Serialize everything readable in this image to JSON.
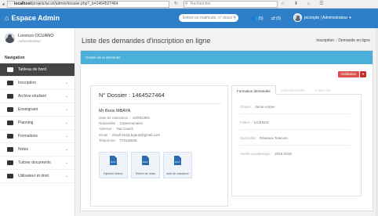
{
  "browser": {
    "url_host": "localhost",
    "url_path": "/projets/iai.sn/admin/dossier.php?_b=1464527464",
    "search_placeholder": "Rechercher",
    "reload_icon": "reload-icon",
    "toolbar_icons": "☆ ⬇ ⌂ ☰"
  },
  "header": {
    "brand": "Espace Admin",
    "search_placeholder": "Entrer un matricule, n° dossi",
    "notif1": "(0)",
    "notif2": "(0)",
    "user_label": "pcompte | Administrateur"
  },
  "sidebar": {
    "profile_name": "Lorenzo OCUANO",
    "profile_role": "Administrateur",
    "nav_heading": "Navigation",
    "items": [
      {
        "label": "Tableau de bord"
      },
      {
        "label": "Inscription"
      },
      {
        "label": "Archive etudiant"
      },
      {
        "label": "Enseignant"
      },
      {
        "label": "Planning"
      },
      {
        "label": "Formations"
      },
      {
        "label": "Notes"
      },
      {
        "label": "Tutorer documents"
      },
      {
        "label": "Utilisateur et droit"
      }
    ]
  },
  "main": {
    "page_title": "Liste des demandes d'inscription en ligne",
    "breadcrumb": [
      "Inscription",
      "Demande en ligne"
    ],
    "panel_header": "Details de la demande",
    "action_button": "Validation",
    "dossier_label": "N° Dossier : 1464527464",
    "person": {
      "name": "Mr Boris MBAYA",
      "rows": [
        {
          "k": "Date de naissance :",
          "v": "15/08/1991"
        },
        {
          "k": "Nationalité :",
          "v": "Camerounaise"
        },
        {
          "k": "Adresse :",
          "v": "Yaa Cauch"
        },
        {
          "k": "Email :",
          "v": "cheyll.kesiji.bgaus@gmail.com"
        },
        {
          "k": "Telephone :",
          "v": "773118838"
        }
      ]
    },
    "documents": [
      {
        "label": "Diplôme obtenu"
      },
      {
        "label": "Relevé de notes"
      },
      {
        "label": "Acte de naissance"
      }
    ],
    "tabs": [
      "Formation demandée",
      "Infos Générales",
      "A bien sûr"
    ],
    "fields": [
      {
        "k": "Classe :",
        "v": "3eme Annee"
      },
      {
        "k": "Filière :",
        "v": "LICENCE"
      },
      {
        "k": "Spécialité :",
        "v": "Réseaux Telecom"
      },
      {
        "k": "Année académique :",
        "v": "2015-2016"
      }
    ]
  }
}
